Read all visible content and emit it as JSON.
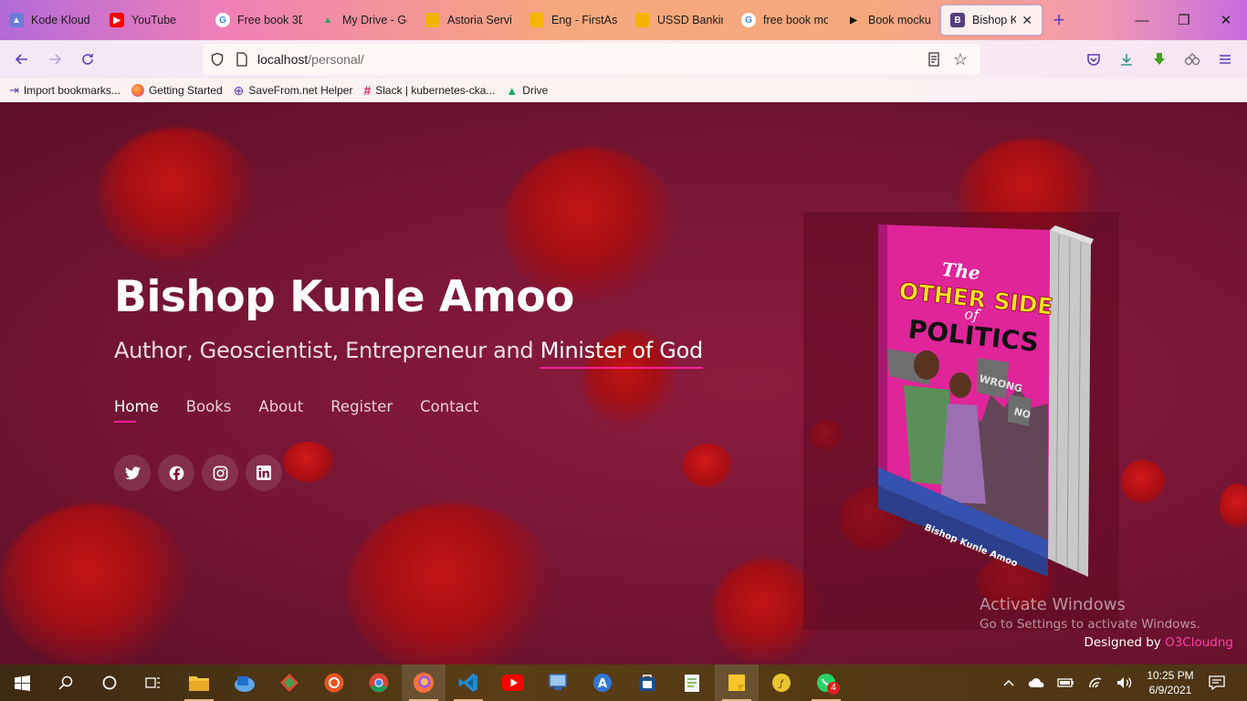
{
  "browser": {
    "tabs": [
      {
        "label": "Kode Kloud -",
        "icon": "kodekloud-icon",
        "color": "#6b7bd8"
      },
      {
        "label": "YouTube",
        "icon": "youtube-icon",
        "color": "#ff0000"
      },
      {
        "label": "Free book 3D",
        "icon": "google-icon",
        "color": "#4285f4"
      },
      {
        "label": "My Drive - Go",
        "icon": "drive-icon",
        "color": "#1fa463"
      },
      {
        "label": "Astoria Servic",
        "icon": "folder-icon",
        "color": "#f4b400"
      },
      {
        "label": "Eng - FirstAst",
        "icon": "folder-icon",
        "color": "#f4b400"
      },
      {
        "label": "USSD Banking",
        "icon": "folder-icon",
        "color": "#f4b400"
      },
      {
        "label": "free book mo",
        "icon": "google-icon",
        "color": "#4285f4"
      },
      {
        "label": "Book mockup",
        "icon": "play-icon",
        "color": "#111111"
      },
      {
        "label": "Bishop Kun",
        "icon": "bootstrap-icon",
        "color": "#563d7c"
      }
    ],
    "url_host": "localhost",
    "url_path": "/personal/",
    "bookmarks": [
      {
        "label": "Import bookmarks...",
        "icon": "import-icon",
        "color": "#5b3fc2"
      },
      {
        "label": "Getting Started",
        "icon": "firefox-icon",
        "color": "#ff7139"
      },
      {
        "label": "SaveFrom.net Helper",
        "icon": "globe-icon",
        "color": "#5b3fc2"
      },
      {
        "label": "Slack | kubernetes-cka...",
        "icon": "slack-icon",
        "color": "#e01e5a"
      },
      {
        "label": "Drive",
        "icon": "drive-icon",
        "color": "#1fa463"
      }
    ]
  },
  "hero": {
    "name": "Bishop Kunle Amoo",
    "subtitle_prefix": "Author, Geoscientist, Entrepreneur and ",
    "subtitle_highlight": "Minister of God",
    "nav": [
      "Home",
      "Books",
      "About",
      "Register",
      "Contact"
    ],
    "active_nav": "Home",
    "social": [
      "twitter-icon",
      "facebook-icon",
      "instagram-icon",
      "linkedin-icon"
    ]
  },
  "book": {
    "title_small": "The",
    "title_line1": "OTHER SIDE",
    "title_of": "of",
    "title_line2": "POLITICS",
    "author": "Bishop Kunle Amoo",
    "signs": [
      "WRONG",
      "NO"
    ]
  },
  "watermark": {
    "line1": "Activate Windows",
    "line2": "Go to Settings to activate Windows."
  },
  "footer": {
    "designed_by": "Designed by ",
    "brand": "O3Cloudng"
  },
  "taskbar": {
    "time": "10:25 PM",
    "date": "6/9/2021",
    "whatsapp_badge": "4"
  },
  "colors": {
    "accent": "#ff1f9a",
    "page_bg": "#7a1636",
    "book_cover": "#e0249a"
  }
}
